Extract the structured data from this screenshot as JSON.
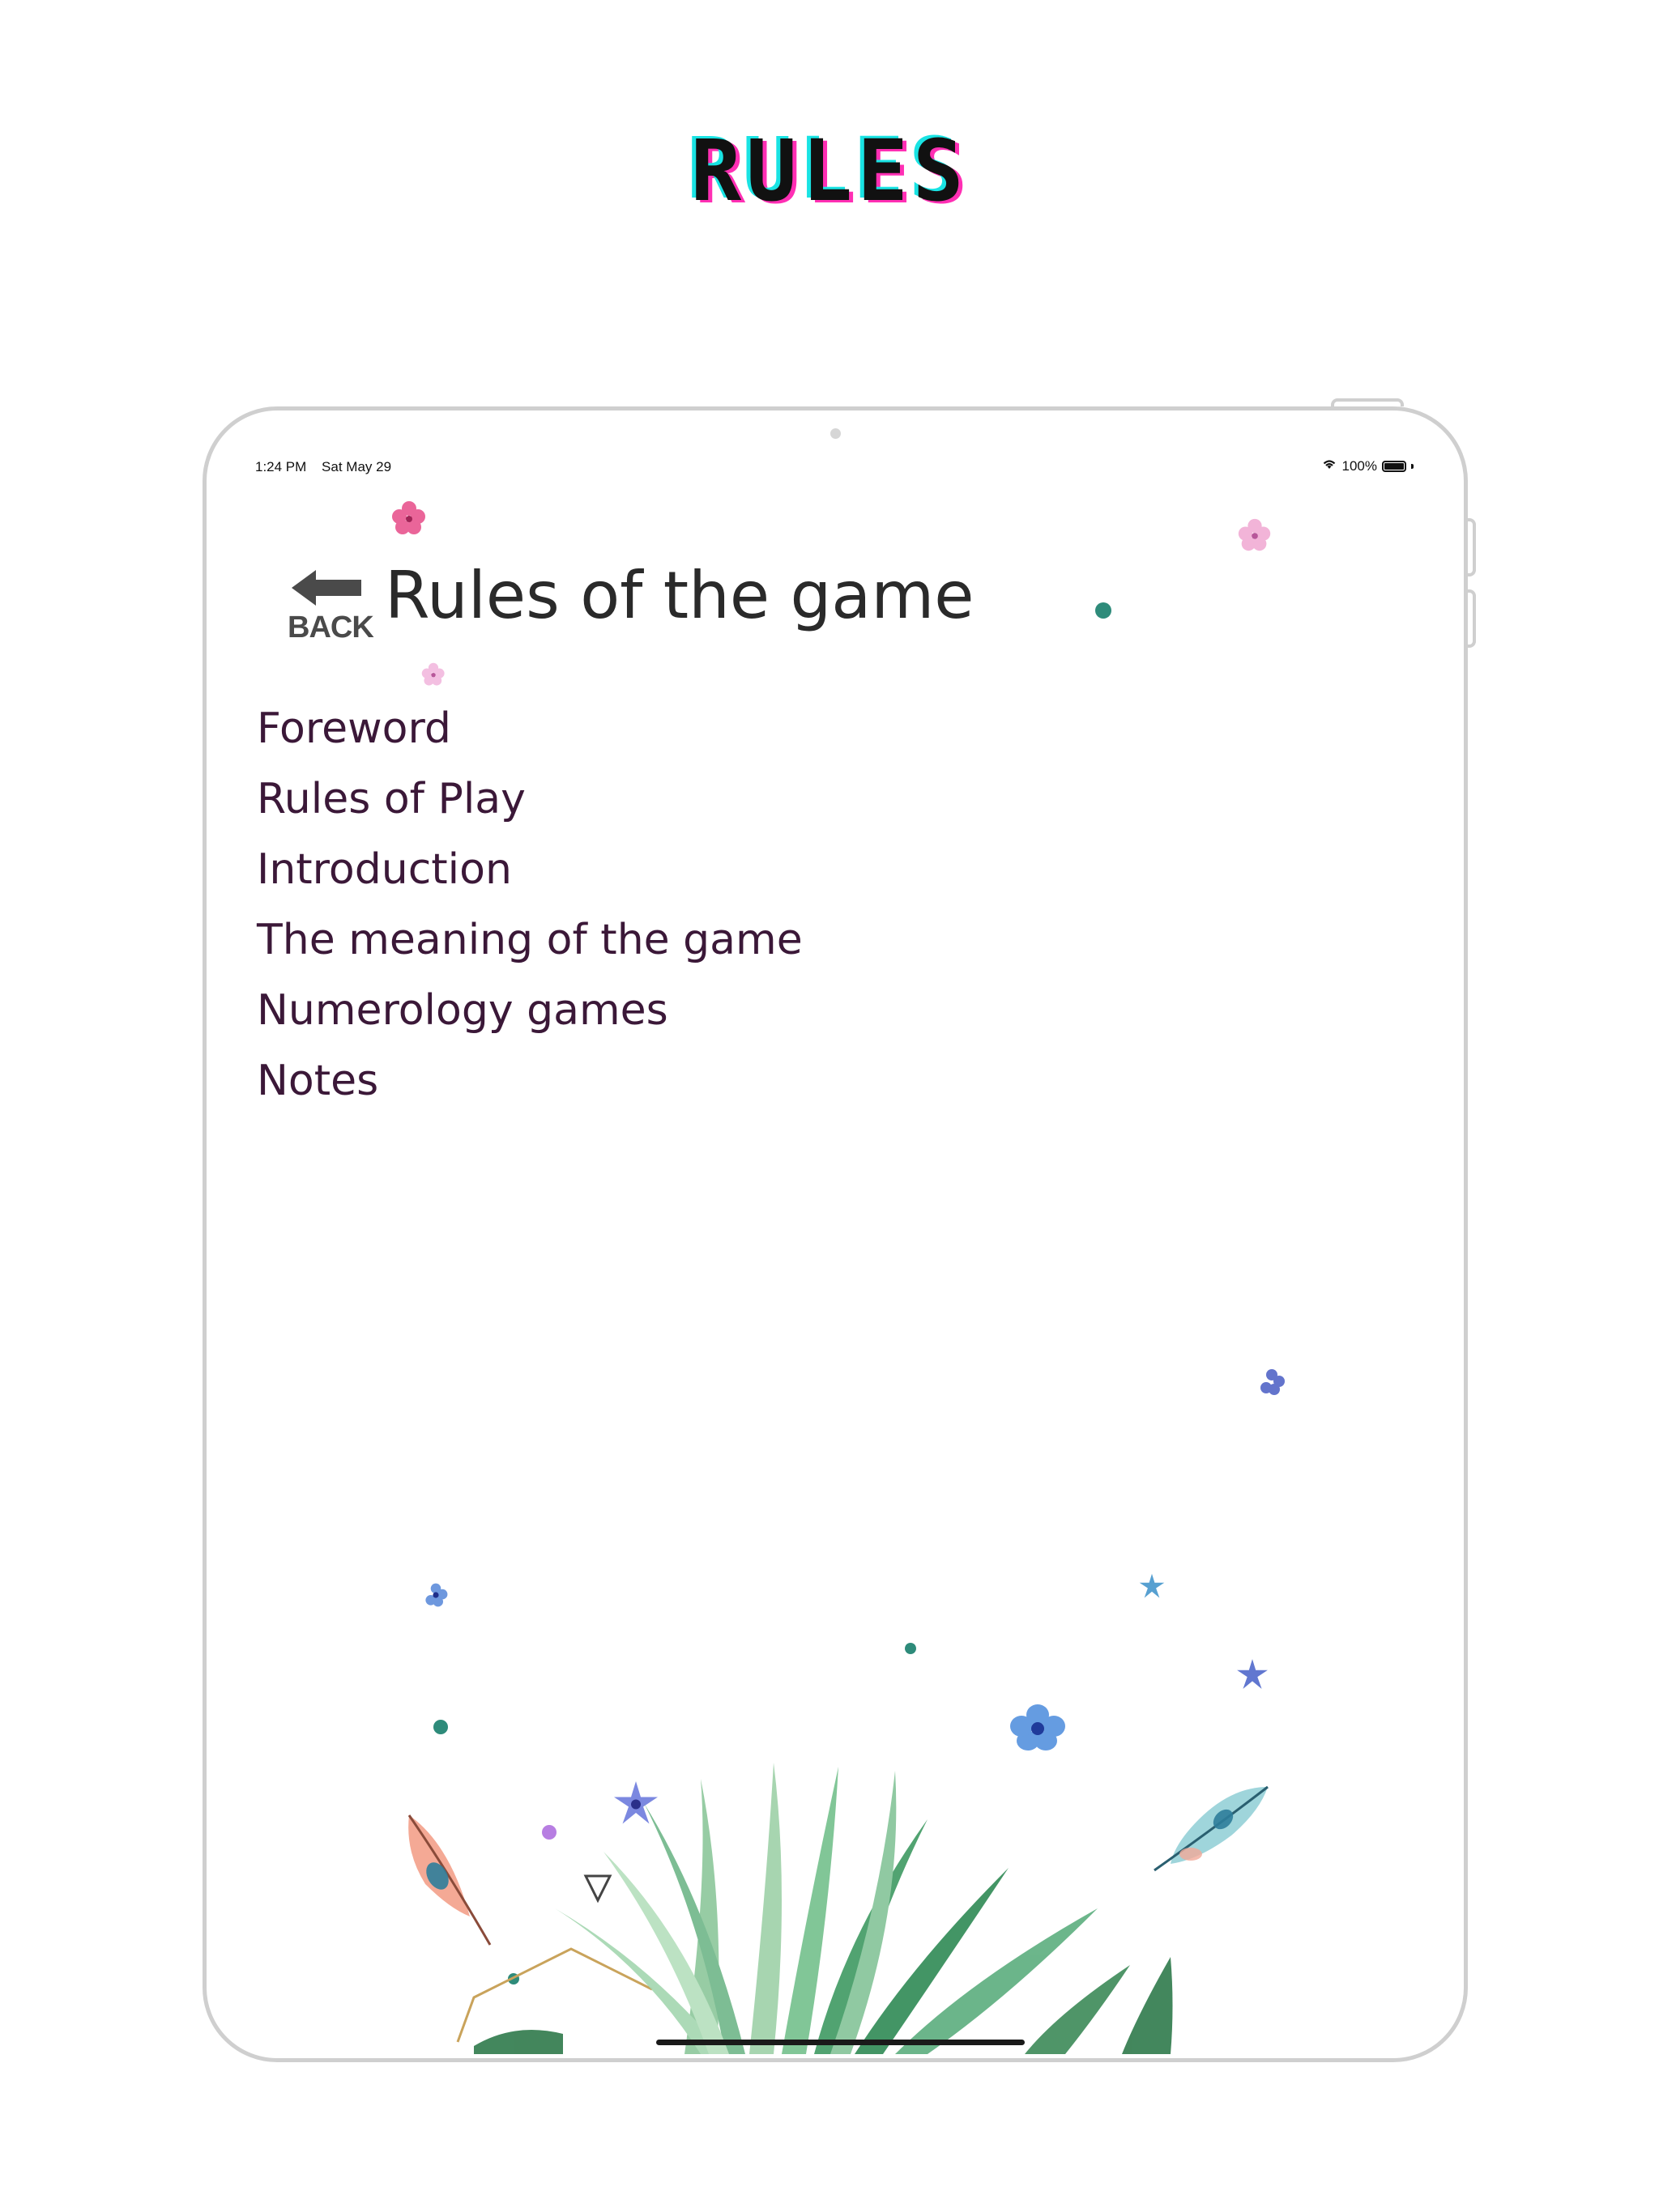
{
  "headline": "RULES",
  "status_bar": {
    "time": "1:24 PM",
    "date": "Sat May 29",
    "battery": "100%"
  },
  "header": {
    "back_label": "BACK",
    "title": "Rules of the game"
  },
  "menu": {
    "items": [
      {
        "label": "Foreword"
      },
      {
        "label": "Rules of Play"
      },
      {
        "label": "Introduction"
      },
      {
        "label": "The meaning of the game"
      },
      {
        "label": "Numerology games"
      },
      {
        "label": "Notes"
      }
    ]
  },
  "icons": {
    "back": "back-arrow-icon",
    "wifi": "wifi-icon",
    "battery": "battery-icon",
    "decoration": "tropical-leaves-illustration"
  },
  "colors": {
    "headline_text": "#111111",
    "headline_cyan_shadow": "#19e3e3",
    "headline_magenta_shadow": "#ff2fb4",
    "menu_text": "#3b1838",
    "title_text": "#2a2a2a",
    "back_icon": "#4a4a4a",
    "device_frame": "#cfcfcf"
  }
}
